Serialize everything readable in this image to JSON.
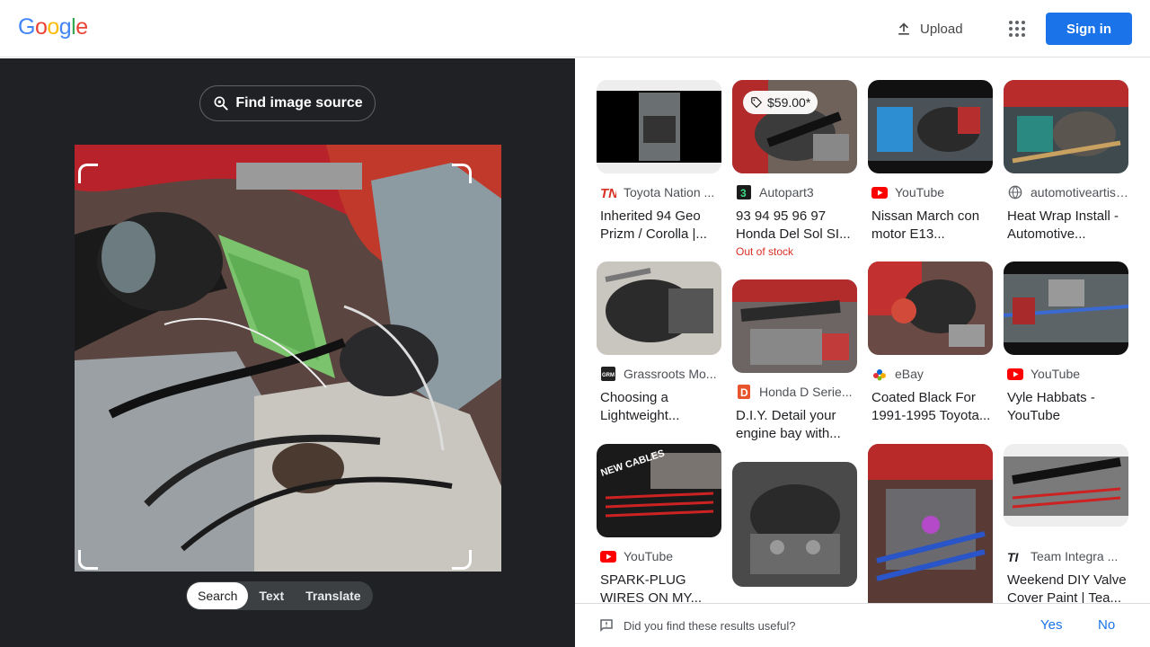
{
  "header": {
    "logo_letters": [
      {
        "char": "G",
        "color": "#4285F4"
      },
      {
        "char": "o",
        "color": "#EA4335"
      },
      {
        "char": "o",
        "color": "#FBBC05"
      },
      {
        "char": "g",
        "color": "#4285F4"
      },
      {
        "char": "l",
        "color": "#34A853"
      },
      {
        "char": "e",
        "color": "#EA4335"
      }
    ],
    "upload_label": "Upload",
    "apps_icon": "apps-grid-icon",
    "signin_label": "Sign in",
    "accent": "#1a73e8"
  },
  "left": {
    "find_source_label": "Find image source",
    "find_source_icon": "lens-search-icon",
    "tabs": [
      {
        "label": "Search",
        "active": true
      },
      {
        "label": "Text",
        "active": false
      },
      {
        "label": "Translate",
        "active": false
      }
    ]
  },
  "results": [
    {
      "source_icon": "tn-logo-icon",
      "source": "Toyota Nation ...",
      "title": "Inherited 94 Geo Prizm / Corolla |...",
      "stock": "",
      "price": ""
    },
    {
      "source_icon": "autopart3-icon",
      "source": "Autopart3",
      "title": "93 94 95 96 97 Honda Del Sol SI...",
      "stock": "Out of stock",
      "price": "$59.00*"
    },
    {
      "source_icon": "youtube-icon",
      "source": "YouTube",
      "title": "Nissan March con motor E13...",
      "stock": "",
      "price": ""
    },
    {
      "source_icon": "globe-icon",
      "source": "automotiveartist...",
      "title": "Heat Wrap Install - Automotive...",
      "stock": "",
      "price": ""
    },
    {
      "source_icon": "grm-icon",
      "source": "Grassroots Mo...",
      "title": "Choosing a Lightweight...",
      "stock": "",
      "price": ""
    },
    {
      "source_icon": "honda-d-icon",
      "source": "Honda D Serie...",
      "title": "D.I.Y. Detail your engine bay with...",
      "stock": "",
      "price": ""
    },
    {
      "source_icon": "ebay-icon",
      "source": "eBay",
      "title": "Coated Black For 1991-1995 Toyota...",
      "stock": "",
      "price": ""
    },
    {
      "source_icon": "youtube-icon",
      "source": "YouTube",
      "title": "Vyle Habbats - YouTube",
      "stock": "",
      "price": ""
    },
    {
      "source_icon": "youtube-icon",
      "source": "YouTube",
      "title": "SPARK-PLUG WIRES ON MY...",
      "stock": "",
      "price": ""
    },
    {
      "source_icon": "",
      "source": "",
      "title": "",
      "stock": "",
      "price": ""
    },
    {
      "source_icon": "",
      "source": "",
      "title": "",
      "stock": "",
      "price": ""
    },
    {
      "source_icon": "ti-logo-icon",
      "source": "Team Integra ...",
      "title": "Weekend DIY Valve Cover Paint | Tea...",
      "stock": "",
      "price": ""
    }
  ],
  "feedback": {
    "question": "Did you find these results useful?",
    "yes": "Yes",
    "no": "No"
  }
}
